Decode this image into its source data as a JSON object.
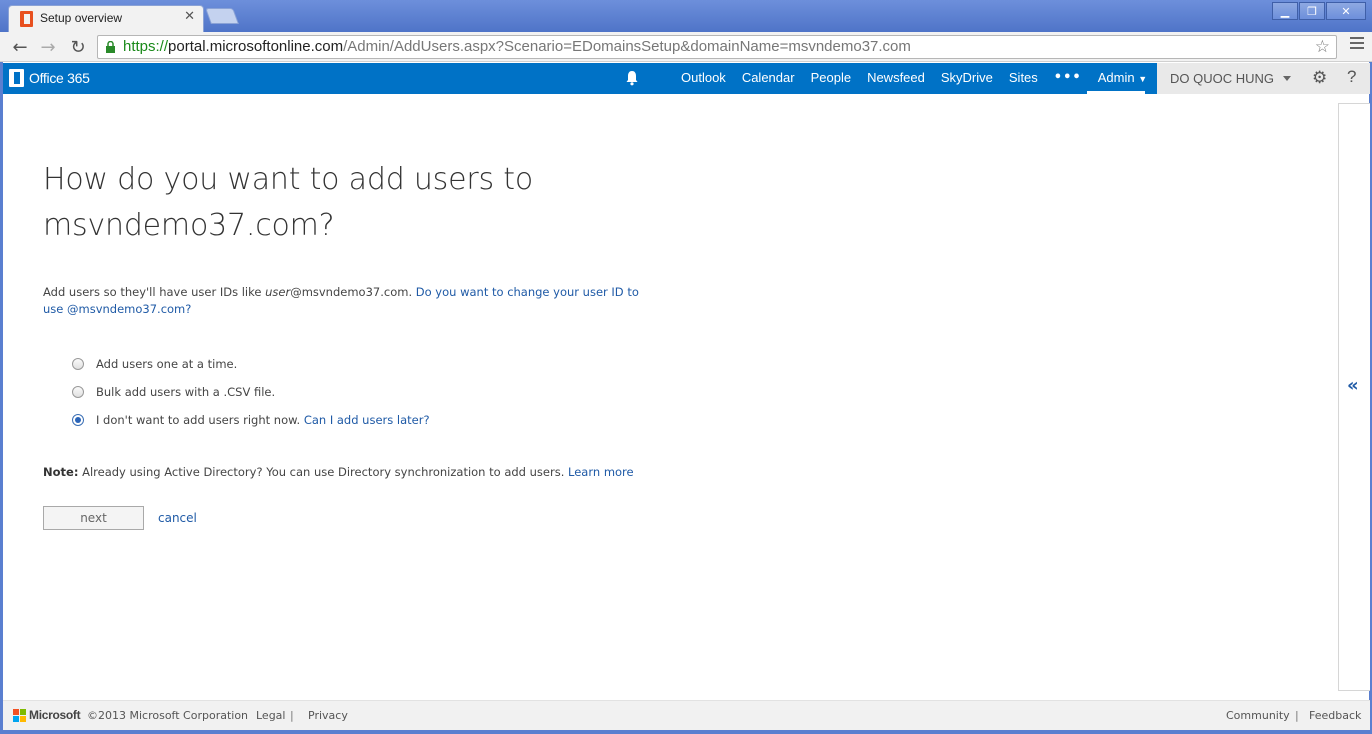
{
  "browser": {
    "tab_title": "Setup overview",
    "url_scheme": "https://",
    "url_host": "portal.microsoftonline.com",
    "url_path": "/Admin/AddUsers.aspx?Scenario=EDomainsSetup&domainName=msvndemo37.com"
  },
  "o365": {
    "logo_text": "Office 365",
    "nav": [
      "Outlook",
      "Calendar",
      "People",
      "Newsfeed",
      "SkyDrive",
      "Sites"
    ],
    "more": "•••",
    "admin": "Admin",
    "user_name": "DO QUOC HUNG",
    "help": "?"
  },
  "main": {
    "title_line1": "How do you want to add users to",
    "title_line2": "msvndemo37.com?",
    "intro_prefix": "Add users so they'll have user IDs like ",
    "intro_italic": "user",
    "intro_suffix": "@msvndemo37.com. ",
    "intro_link": "Do you want to change your user ID to use @msvndemo37.com?",
    "options": [
      {
        "label": "Add users one at a time.",
        "checked": false
      },
      {
        "label": "Bulk add users with a .CSV file.",
        "checked": false
      },
      {
        "label": "I don't want to add users right now.",
        "checked": true,
        "link": "Can I add users later?"
      }
    ],
    "note_label": "Note:",
    "note_text": " Already using Active Directory? You can use Directory synchronization to add users. ",
    "note_link": "Learn more",
    "next_label": "next",
    "cancel_label": "cancel",
    "side_arrow": "«"
  },
  "footer": {
    "brand": "Microsoft",
    "copyright": "©2013 Microsoft Corporation",
    "legal": "Legal",
    "privacy": "Privacy",
    "community": "Community",
    "feedback": "Feedback",
    "separator": "|"
  },
  "colors": {
    "brand_blue": "#0072c6",
    "link_blue": "#1f5aa6"
  }
}
